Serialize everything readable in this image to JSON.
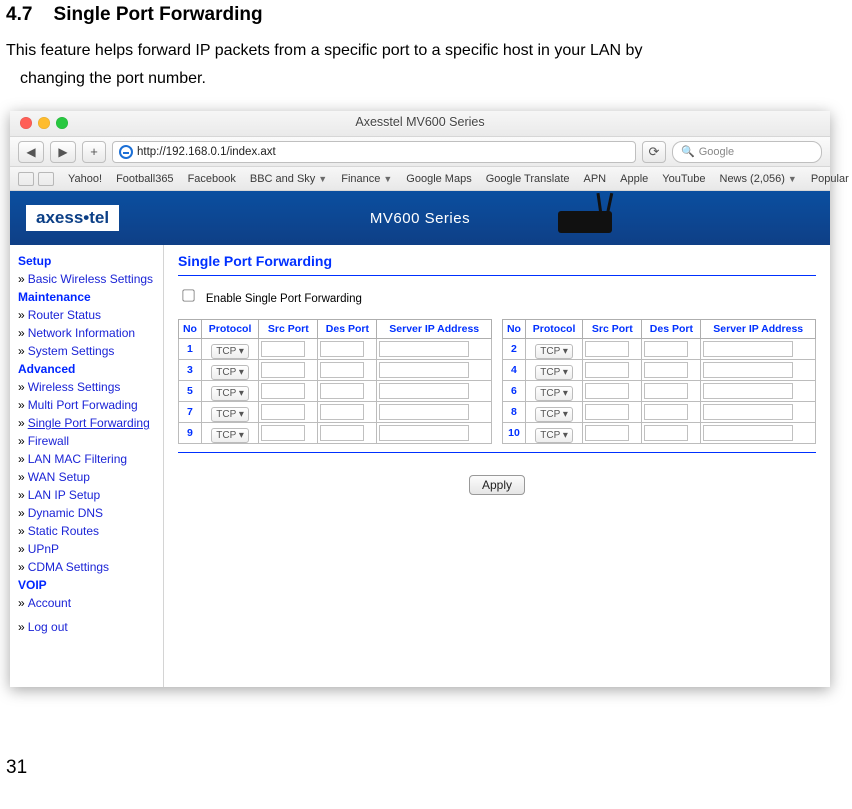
{
  "doc": {
    "section_no": "4.7",
    "section_title": "Single Port Forwarding",
    "paragraph_line1": "This feature helps forward IP packets from a specific port to a specific host in your LAN by",
    "paragraph_line2": "changing the port number.",
    "page_number": "31"
  },
  "browser": {
    "window_title": "Axesstel MV600 Series",
    "url": "http://192.168.0.1/index.axt",
    "search_placeholder": "Google",
    "bookmarks": [
      "Yahoo!",
      "Football365",
      "Facebook",
      "BBC and Sky",
      "Finance",
      "Google Maps",
      "Google Translate",
      "APN",
      "Apple",
      "YouTube",
      "News (2,056)",
      "Popular"
    ]
  },
  "header": {
    "brand": "axess•tel",
    "product": "MV600 Series"
  },
  "sidebar": {
    "groups": [
      {
        "title": "Setup",
        "items": [
          "Basic Wireless Settings"
        ]
      },
      {
        "title": "Maintenance",
        "items": [
          "Router Status",
          "Network Information",
          "System Settings"
        ]
      },
      {
        "title": "Advanced",
        "items": [
          "Wireless Settings",
          "Multi Port Forwading",
          "Single Port Forwarding",
          "Firewall",
          "LAN MAC Filtering",
          "WAN Setup",
          "LAN IP Setup",
          "Dynamic DNS",
          "Static Routes",
          "UPnP",
          "CDMA Settings"
        ]
      },
      {
        "title": "VOIP",
        "items": [
          "Account"
        ]
      },
      {
        "title": "",
        "items": [
          "Log out"
        ]
      }
    ],
    "active": "Single Port Forwarding"
  },
  "page": {
    "title": "Single Port Forwarding",
    "enable_label": "Enable Single Port Forwarding",
    "columns": [
      "No",
      "Protocol",
      "Src Port",
      "Des Port",
      "Server IP Address"
    ],
    "protocol_value": "TCP",
    "left_rows": [
      "1",
      "3",
      "5",
      "7",
      "9"
    ],
    "right_rows": [
      "2",
      "4",
      "6",
      "8",
      "10"
    ],
    "apply_label": "Apply"
  }
}
